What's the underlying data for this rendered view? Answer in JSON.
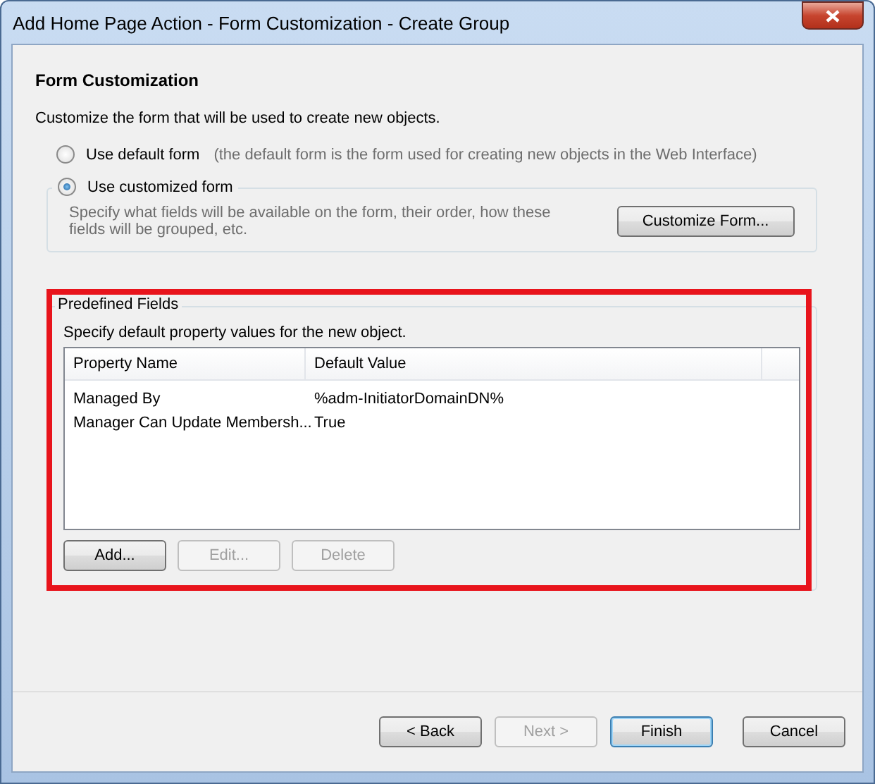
{
  "window": {
    "title": "Add Home Page Action - Form Customization - Create Group"
  },
  "heading": "Form Customization",
  "description": "Customize the form that will be used to create new objects.",
  "options": [
    {
      "label": "Use default form",
      "note": "(the default form is the form used for creating new objects in the Web Interface)",
      "selected": false
    },
    {
      "label": "Use customized form",
      "selected": true,
      "detail": "Specify what fields will be available on the form, their order, how these fields will be grouped, etc.",
      "button": "Customize Form..."
    }
  ],
  "predefined_fields": {
    "title": "Predefined Fields",
    "highlighted": true,
    "hint": "Specify default property values for the new object.",
    "columns": [
      "Property Name",
      "Default Value"
    ],
    "rows": [
      [
        "Managed By",
        "%adm-InitiatorDomainDN%"
      ],
      [
        "Manager Can Update Membersh...",
        "True"
      ]
    ],
    "buttons": [
      {
        "label": "Add...",
        "disabled": false
      },
      {
        "label": "Edit...",
        "disabled": true
      },
      {
        "label": "Delete",
        "disabled": true
      }
    ]
  },
  "footer_buttons": [
    {
      "label": "< Back",
      "disabled": false,
      "default": false
    },
    {
      "label": "Next >",
      "disabled": true,
      "default": false
    },
    {
      "label": "Finish",
      "disabled": false,
      "default": true
    },
    {
      "label": "Cancel",
      "disabled": false,
      "default": false
    }
  ]
}
